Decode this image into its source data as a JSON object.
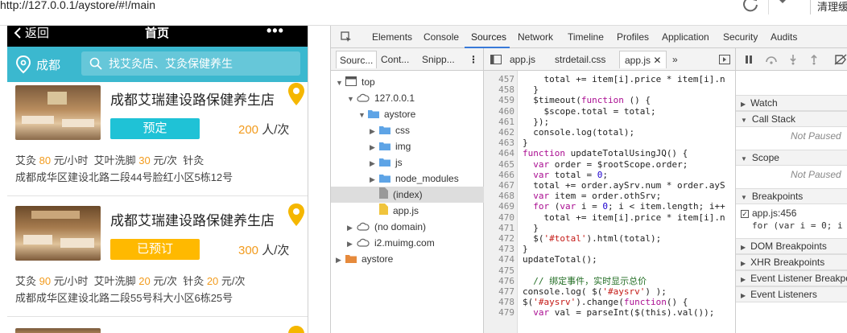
{
  "browser": {
    "url": "http://127.0.0.1/aystore/#!/main",
    "clear_label": "清理缓"
  },
  "app": {
    "back_label": "返回",
    "title": "首页",
    "more_label": "•••",
    "city": "成都",
    "search_placeholder": "找艾灸店、艾灸保健养生",
    "colors": {
      "search_bg": "#3bb8cf",
      "accent": "#f29b1d",
      "book": "#1fc2d6",
      "booked": "#ffb900"
    }
  },
  "stores": [
    {
      "name": "成都艾瑞建设路保健养生店",
      "button_label": "预定",
      "button_state": "available",
      "price": "200",
      "price_unit": "人/次",
      "services": [
        {
          "name": "艾灸",
          "price": "80",
          "unit": "元/小时"
        },
        {
          "name": "艾叶洗脚",
          "price": "30",
          "unit": "元/次"
        },
        {
          "name": "针灸",
          "price": "",
          "unit": ""
        }
      ],
      "address": "成都成华区建设北路二段44号脸红小区5栋12号"
    },
    {
      "name": "成都艾瑞建设路保健养生店",
      "button_label": "已预订",
      "button_state": "booked",
      "price": "300",
      "price_unit": "人/次",
      "services": [
        {
          "name": "艾灸",
          "price": "90",
          "unit": "元/小时"
        },
        {
          "name": "艾叶洗脚",
          "price": "20",
          "unit": "元/次"
        },
        {
          "name": "针灸",
          "price": "20",
          "unit": "元/次"
        }
      ],
      "address": "成都成华区建设北路二段55号科大小区6栋25号"
    }
  ],
  "devtools": {
    "tabs": [
      "Elements",
      "Console",
      "Sources",
      "Network",
      "Timeline",
      "Profiles",
      "Application",
      "Security",
      "Audits"
    ],
    "active_tab": "Sources",
    "navigator_tabs": [
      "Sourc...",
      "Cont...",
      "Snipp..."
    ],
    "tree": [
      {
        "label": "top",
        "icon": "window-icon",
        "depth": 0,
        "expanded": true
      },
      {
        "label": "127.0.0.1",
        "icon": "cloud-icon",
        "depth": 1,
        "expanded": true
      },
      {
        "label": "aystore",
        "icon": "folder-icon",
        "depth": 2,
        "expanded": true
      },
      {
        "label": "css",
        "icon": "folder-icon",
        "depth": 3,
        "expanded": false
      },
      {
        "label": "img",
        "icon": "folder-icon",
        "depth": 3,
        "expanded": false
      },
      {
        "label": "js",
        "icon": "folder-icon",
        "depth": 3,
        "expanded": false
      },
      {
        "label": "node_modules",
        "icon": "folder-icon",
        "depth": 3,
        "expanded": false
      },
      {
        "label": "(index)",
        "icon": "file-gray-icon",
        "depth": 3,
        "selected": true
      },
      {
        "label": "app.js",
        "icon": "file-yellow-icon",
        "depth": 3
      },
      {
        "label": "(no domain)",
        "icon": "cloud-icon",
        "depth": 1,
        "expanded": false
      },
      {
        "label": "i2.muimg.com",
        "icon": "cloud-icon",
        "depth": 1,
        "expanded": false
      },
      {
        "label": "aystore",
        "icon": "folder-orange-icon",
        "depth": 0,
        "expanded": false
      }
    ],
    "editor_tabs": [
      "app.js",
      "strdetail.css",
      "app.js"
    ],
    "code_lines": [
      {
        "n": "457",
        "text": "    total += item[i].price * item[i].n"
      },
      {
        "n": "458",
        "text": "  }"
      },
      {
        "n": "459",
        "text": "  $timeout(function () {"
      },
      {
        "n": "460",
        "text": "    $scope.total = total;"
      },
      {
        "n": "461",
        "text": "  });"
      },
      {
        "n": "462",
        "text": "  console.log(total);"
      },
      {
        "n": "463",
        "text": "}"
      },
      {
        "n": "464",
        "text": "function updateTotalUsingJQ() {"
      },
      {
        "n": "465",
        "text": "  var order = $rootScope.order;"
      },
      {
        "n": "466",
        "text": "  var total = 0;"
      },
      {
        "n": "467",
        "text": "  total += order.aySrv.num * order.ayS"
      },
      {
        "n": "468",
        "text": "  var item = order.othSrv;"
      },
      {
        "n": "469",
        "text": "  for (var i = 0; i < item.length; i++"
      },
      {
        "n": "470",
        "text": "    total += item[i].price * item[i].n"
      },
      {
        "n": "471",
        "text": "  }"
      },
      {
        "n": "472",
        "text": "  $('#total').html(total);"
      },
      {
        "n": "473",
        "text": "}"
      },
      {
        "n": "474",
        "text": "updateTotal();"
      },
      {
        "n": "475",
        "text": ""
      },
      {
        "n": "476",
        "text": "  // 绑定事件，实时显示总价"
      },
      {
        "n": "477",
        "text": "console.log( $('#aysrv') );"
      },
      {
        "n": "478",
        "text": "$('#aysrv').change(function() {"
      },
      {
        "n": "479",
        "text": "  var val = parseInt($(this).val());"
      }
    ],
    "debugger_sections": {
      "watch": "Watch",
      "call_stack": "Call Stack",
      "call_stack_status": "Not Paused",
      "scope": "Scope",
      "scope_status": "Not Paused",
      "breakpoints": "Breakpoints",
      "breakpoint_file": "app.js:456",
      "breakpoint_code": "for (var i = 0; i",
      "dom_breakpoints": "DOM Breakpoints",
      "xhr_breakpoints": "XHR Breakpoints",
      "event_listener_breakpoints": "Event Listener Breakpo",
      "event_listeners": "Event Listeners"
    }
  }
}
